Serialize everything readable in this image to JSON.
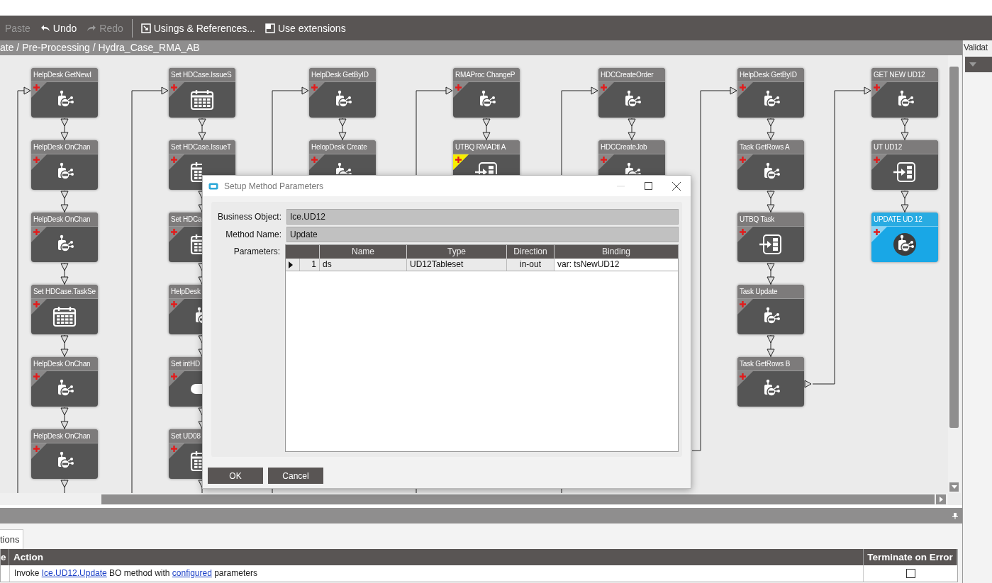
{
  "toolbar": [
    {
      "kind": "button",
      "label": "Paste",
      "disabled": true
    },
    {
      "kind": "button",
      "label": "Undo",
      "disabled": false
    },
    {
      "kind": "button",
      "label": "Redo",
      "disabled": true
    },
    {
      "kind": "separator"
    },
    {
      "kind": "button",
      "label": "Usings & References...",
      "disabled": false
    },
    {
      "kind": "button",
      "label": "Use extensions",
      "disabled": false
    }
  ],
  "breadcrumb": "ate / Pre-Processing / Hydra_Case_RMA_AB",
  "side_panel": {
    "title": "Validat"
  },
  "canvas": {
    "columns": [
      {
        "nodes": [
          {
            "title": "HelpDesk GetNewI",
            "kind": "method",
            "selected": false,
            "warning": false
          },
          {
            "title": "HelpDesk OnChan",
            "kind": "method",
            "selected": false,
            "warning": false
          },
          {
            "title": "HelpDesk OnChan",
            "kind": "method",
            "selected": false,
            "warning": false
          },
          {
            "title": "Set HDCase.TaskSe",
            "kind": "calendar",
            "selected": false,
            "warning": false
          },
          {
            "title": "HelpDesk OnChan",
            "kind": "method",
            "selected": false,
            "warning": false
          },
          {
            "title": "HelpDesk OnChan",
            "kind": "method",
            "selected": false,
            "warning": false
          }
        ]
      },
      {
        "nodes": [
          {
            "title": "Set HDCase.IssueS",
            "kind": "calendar",
            "selected": false,
            "warning": false
          },
          {
            "title": "Set HDCase.IssueT",
            "kind": "calendar",
            "selected": false,
            "warning": false
          },
          {
            "title": "Set HDCa",
            "kind": "calendar",
            "selected": false,
            "warning": false
          },
          {
            "title": "HelpDesk",
            "kind": "method",
            "selected": false,
            "warning": false
          },
          {
            "title": "Set intHD",
            "kind": "text",
            "selected": false,
            "warning": false
          },
          {
            "title": "Set UD08",
            "kind": "calendar",
            "selected": false,
            "warning": false
          }
        ]
      },
      {
        "nodes": [
          {
            "title": "HelpDesk GetByID",
            "kind": "method",
            "selected": false,
            "warning": false
          },
          {
            "title": "HelopDesk Create",
            "kind": "method",
            "selected": false,
            "warning": false
          }
        ]
      },
      {
        "nodes": [
          {
            "title": "RMAProc ChangeP",
            "kind": "method",
            "selected": false,
            "warning": false
          },
          {
            "title": "UTBQ RMADtl A",
            "kind": "import",
            "selected": false,
            "warning": true
          }
        ]
      },
      {
        "nodes": [
          {
            "title": "HDCCreateOrder",
            "kind": "method",
            "selected": false,
            "warning": false
          },
          {
            "title": "HDCCreateJob",
            "kind": "method",
            "selected": false,
            "warning": false
          }
        ]
      },
      {
        "nodes": [
          {
            "title": "HelpDesk GetByID",
            "kind": "method",
            "selected": false,
            "warning": false
          },
          {
            "title": "Task GetRows A",
            "kind": "method",
            "selected": false,
            "warning": false
          },
          {
            "title": "UTBQ Task",
            "kind": "import",
            "selected": false,
            "warning": false
          },
          {
            "title": "Task Update",
            "kind": "method",
            "selected": false,
            "warning": false
          },
          {
            "title": "Task GetRows B",
            "kind": "method",
            "selected": false,
            "warning": false
          }
        ]
      },
      {
        "nodes": [
          {
            "title": "GET NEW UD12",
            "kind": "method",
            "selected": false,
            "warning": false
          },
          {
            "title": "UT UD12",
            "kind": "import",
            "selected": false,
            "warning": false
          },
          {
            "title": "UPDATE UD 12",
            "kind": "method",
            "selected": true,
            "warning": false
          }
        ]
      }
    ]
  },
  "dialog": {
    "title": "Setup Method Parameters",
    "fields": [
      {
        "label": "Business Object:",
        "value": "Ice.UD12"
      },
      {
        "label": "Method Name:",
        "value": "Update"
      }
    ],
    "parameters": {
      "label": "Parameters:",
      "columns": [
        "Name",
        "Type",
        "Direction",
        "Binding"
      ],
      "rows": [
        {
          "number": "1",
          "name": "ds",
          "type": "UD12Tableset",
          "direction": "in-out",
          "binding": "var: tsNewUD12",
          "selected": true
        }
      ]
    },
    "buttons": [
      "OK",
      "Cancel"
    ]
  },
  "bottom": {
    "tabs": [
      {
        "label": "tions",
        "selected": true
      }
    ],
    "table": {
      "columns": [
        "e",
        "Action",
        "Terminate on Error"
      ],
      "rows": [
        {
          "action": [
            {
              "kind": "text",
              "text": "Invoke "
            },
            {
              "kind": "link",
              "text": "Ice.UD12.Update"
            },
            {
              "kind": "text",
              "text": " BO method with "
            },
            {
              "kind": "link",
              "text": "configured"
            },
            {
              "kind": "text",
              "text": " parameters"
            }
          ],
          "terminate_on_error": false
        }
      ]
    }
  }
}
